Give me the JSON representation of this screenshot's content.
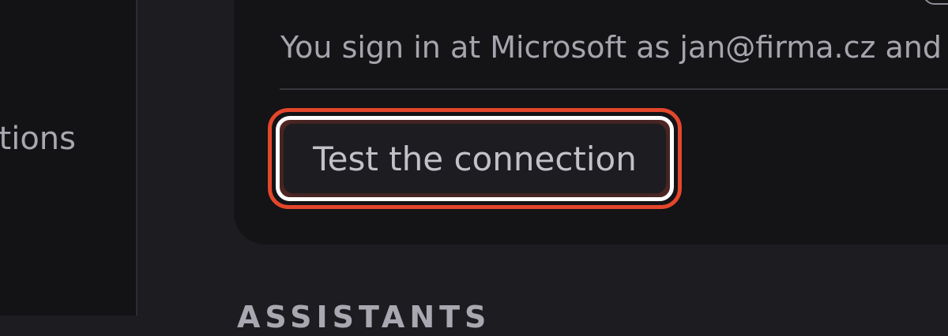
{
  "sidebar": {
    "active_item_label": "tions"
  },
  "connection": {
    "description": "You sign in at Microsoft as jan@firma.cz and a",
    "test_button_label": "Test the connection"
  },
  "sections": {
    "next_heading": "ASSISTANTS"
  },
  "colors": {
    "background": "#1d1c21",
    "sidebar_background": "#131215",
    "card_background": "#141316",
    "focus_ring": "#e3472b",
    "button_border": "#ffffff",
    "text_primary": "#c2c1c8",
    "text_secondary": "#a6a5ad"
  }
}
